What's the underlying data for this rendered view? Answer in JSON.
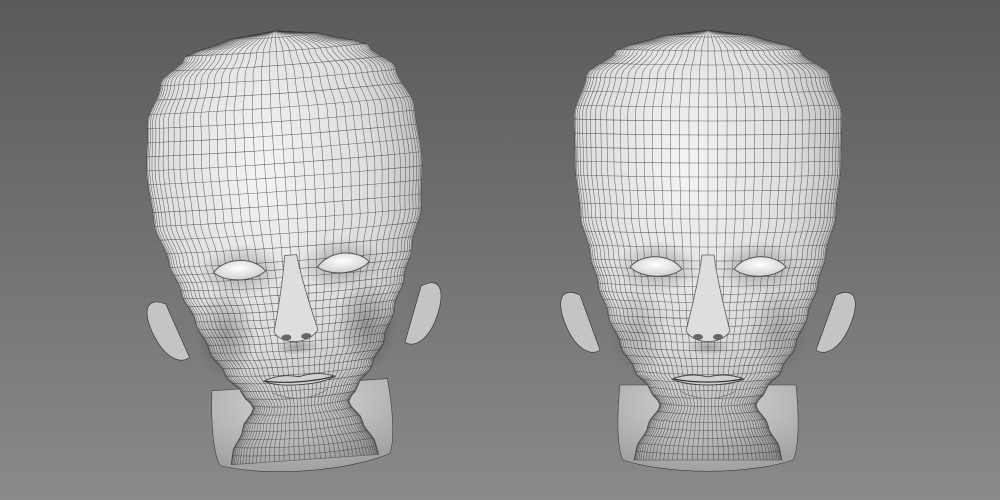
{
  "scene": {
    "background_top": "#5a5a5a",
    "background_bottom": "#8a8a8a",
    "surface_light": "#f2f2f2",
    "surface_mid": "#c9c9c9",
    "surface_dark": "#8f8f8f",
    "wire_color": "#3b3b3b",
    "models": [
      {
        "name": "head-model-left",
        "icon": "wireframe-head"
      },
      {
        "name": "head-model-right",
        "icon": "wireframe-head"
      }
    ]
  }
}
